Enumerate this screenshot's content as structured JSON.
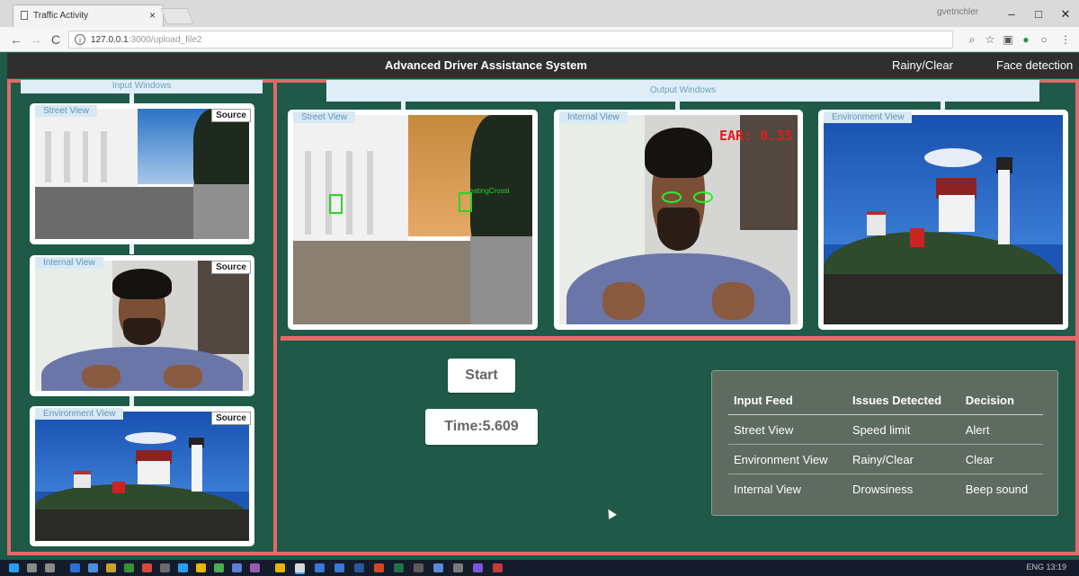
{
  "browser": {
    "tab_title": "Traffic Activity",
    "tab_close": "×",
    "profile": "gvetrichler",
    "url_host": "127.0.0.1",
    "url_rest": ":3000/upload_file2",
    "controls": {
      "min": "–",
      "max": "□",
      "close": "✕"
    },
    "nav": {
      "back": "←",
      "forward": "→",
      "reload": "C"
    },
    "icons": [
      "search-icon",
      "star-icon",
      "cast-icon",
      "extension-icon",
      "menu-icon"
    ]
  },
  "app": {
    "title": "Advanced Driver Assistance System",
    "nav": [
      "Rainy/Clear",
      "Face detection"
    ]
  },
  "input_windows": {
    "header": "Input Windows",
    "source_label": "Source",
    "cards": [
      {
        "label": "Street View"
      },
      {
        "label": "Internal View"
      },
      {
        "label": "Environment View"
      }
    ]
  },
  "output_windows": {
    "header": "Output Windows",
    "cards": [
      {
        "label": "Street View",
        "detections": [
          "",
          "eatingCrossi"
        ]
      },
      {
        "label": "Internal View",
        "ear_text": "EAR: 0.35"
      },
      {
        "label": "Environment View"
      }
    ]
  },
  "controls": {
    "start_label": "Start",
    "time_text": "Time:5.609"
  },
  "issues_table": {
    "headers": [
      "Input Feed",
      "Issues Detected",
      "Decision"
    ],
    "rows": [
      [
        "Street View",
        "Speed limit",
        "Alert"
      ],
      [
        "Environment View",
        "Rainy/Clear",
        "Clear"
      ],
      [
        "Internal View",
        "Drowsiness",
        "Beep sound"
      ]
    ]
  },
  "colors": {
    "page_bg": "#1f5a49",
    "frame_accent": "#e36a6a",
    "app_header": "#2f2f2f",
    "tag_bg": "#d7e9f4",
    "table_bg": "#5d6b60"
  },
  "taskbar": {
    "tray_text": "ENG 13:19"
  }
}
